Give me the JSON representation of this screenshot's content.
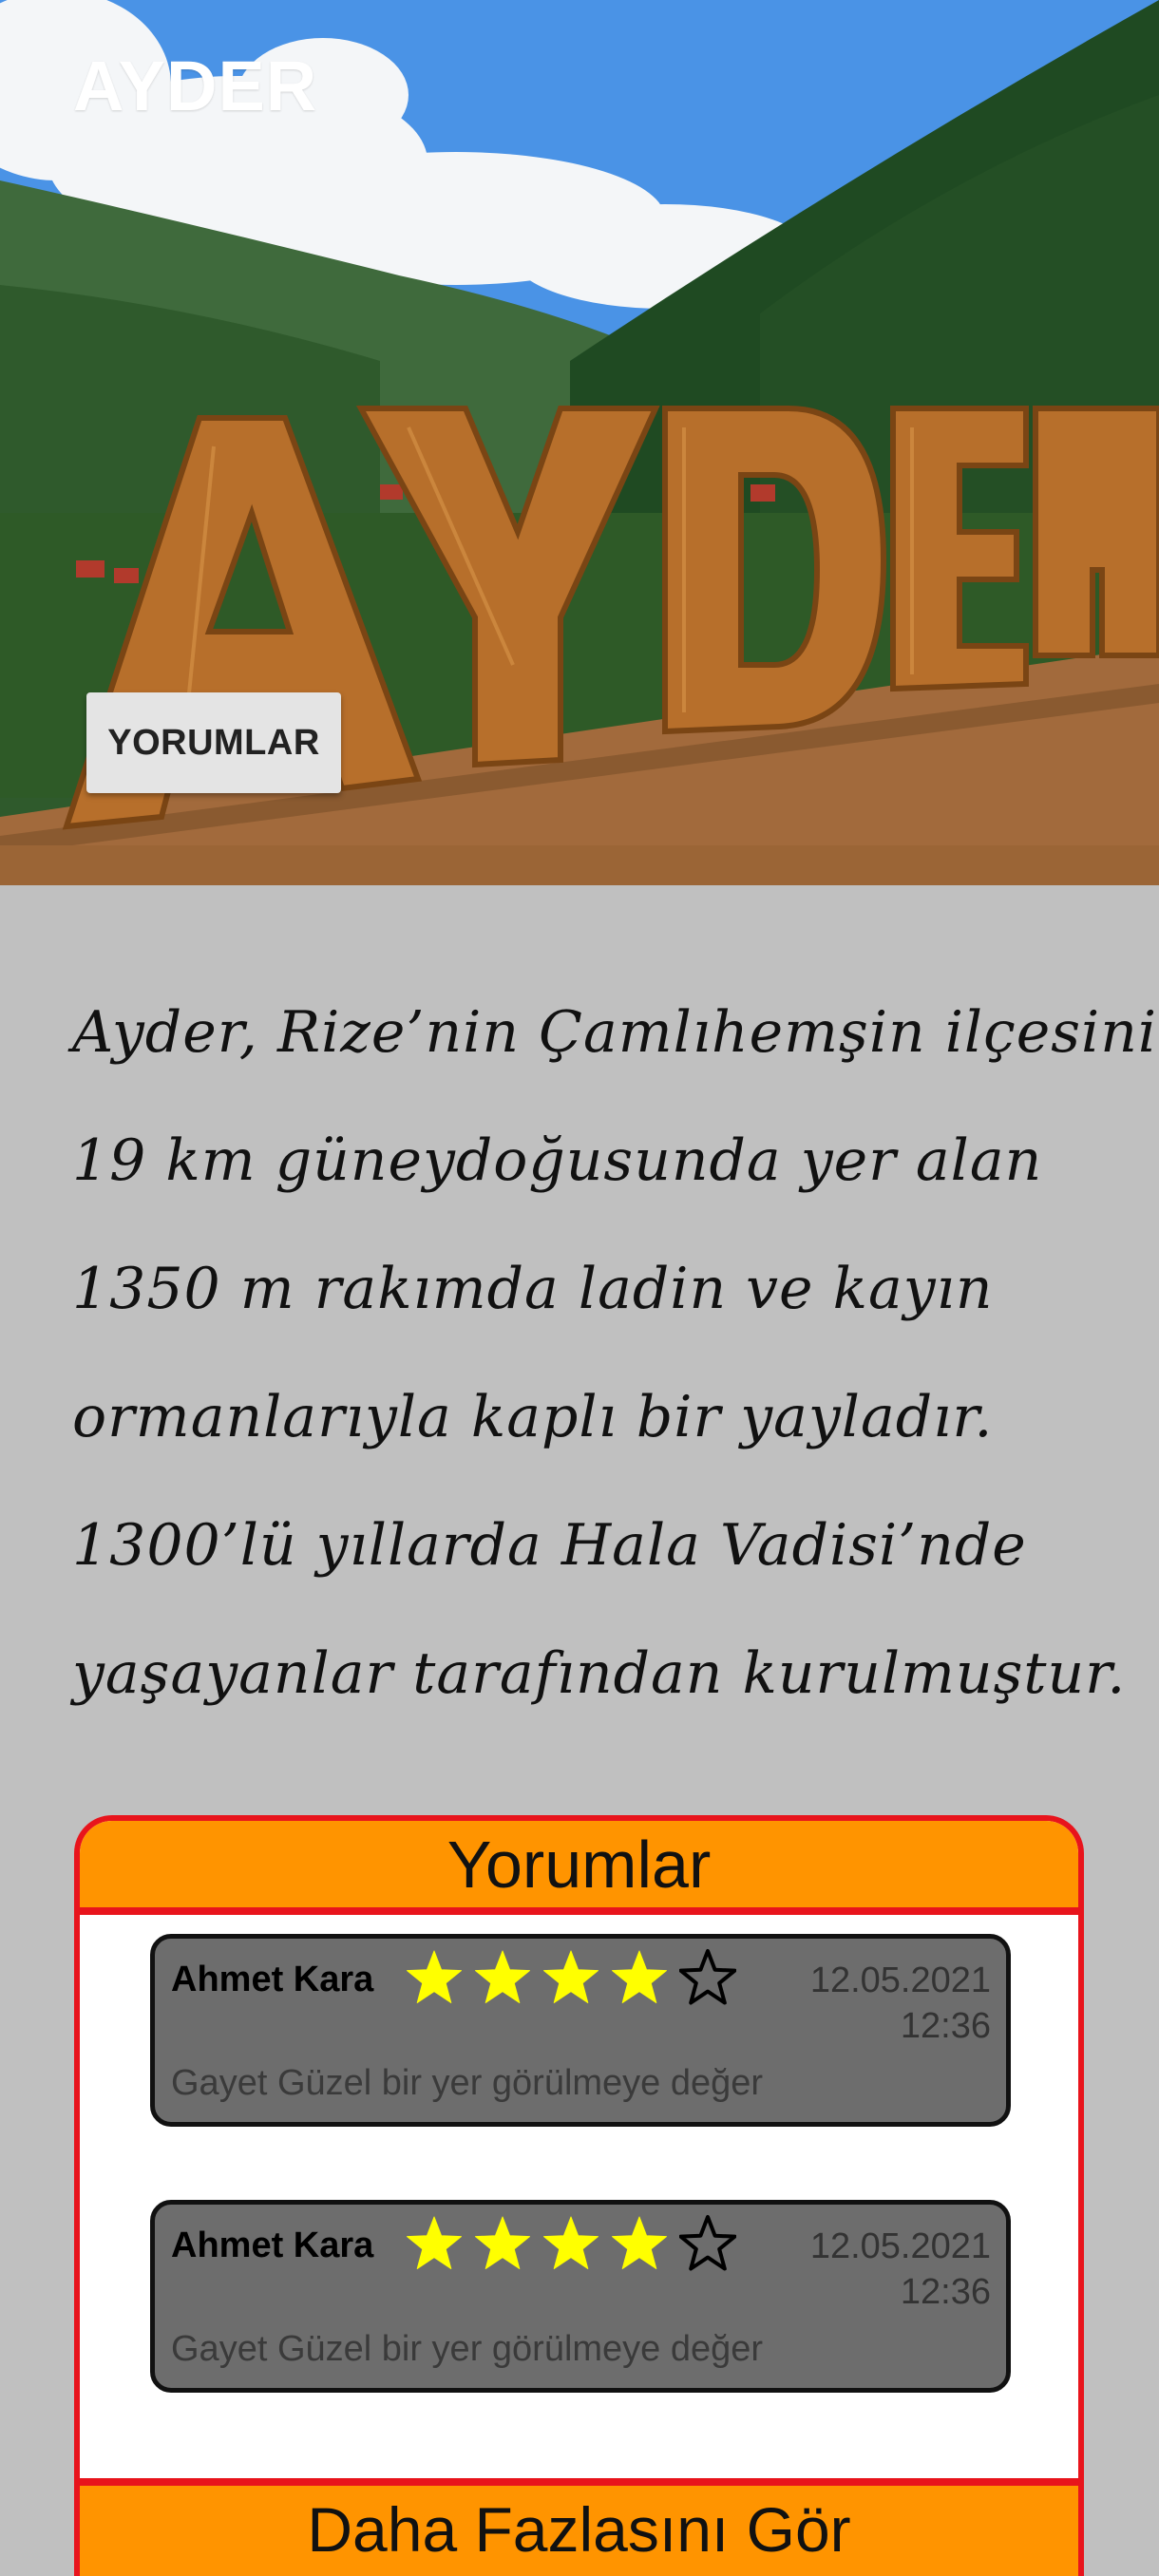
{
  "app_bar": {
    "title": "AYDER"
  },
  "hero": {
    "sign_text": "AYDER",
    "comments_button_label": "YORUMLAR"
  },
  "description": {
    "lines": [
      "Ayder, Rize’nin Çamlıhemşin ilçesinin",
      "19 km güneydoğusunda yer alan",
      "1350 m rakımda ladin ve kayın",
      "ormanlarıyla kaplı bir yayladır.",
      "1300’lü yıllarda Hala Vadisi’nde",
      "yaşayanlar tarafından kurulmuştur."
    ]
  },
  "reviews": {
    "header": "Yorumlar",
    "items": [
      {
        "author": "Ahmet Kara",
        "rating": 4,
        "max_rating": 5,
        "date": "12.05.2021",
        "time": "12:36",
        "comment": "Gayet Güzel bir yer görülmeye değer"
      },
      {
        "author": "Ahmet Kara",
        "rating": 4,
        "max_rating": 5,
        "date": "12.05.2021",
        "time": "12:36",
        "comment": "Gayet Güzel bir yer görülmeye değer"
      }
    ],
    "more_button_label": "Daha Fazlasını Gör"
  },
  "colors": {
    "background": "#c0c0c0",
    "panel_accent": "#ff9400",
    "panel_border": "#e8141c",
    "card_background": "#6d6d6d",
    "star_filled": "#ffff00"
  },
  "icons": {
    "filled_star": "star-filled-icon",
    "empty_star": "star-outline-icon"
  }
}
